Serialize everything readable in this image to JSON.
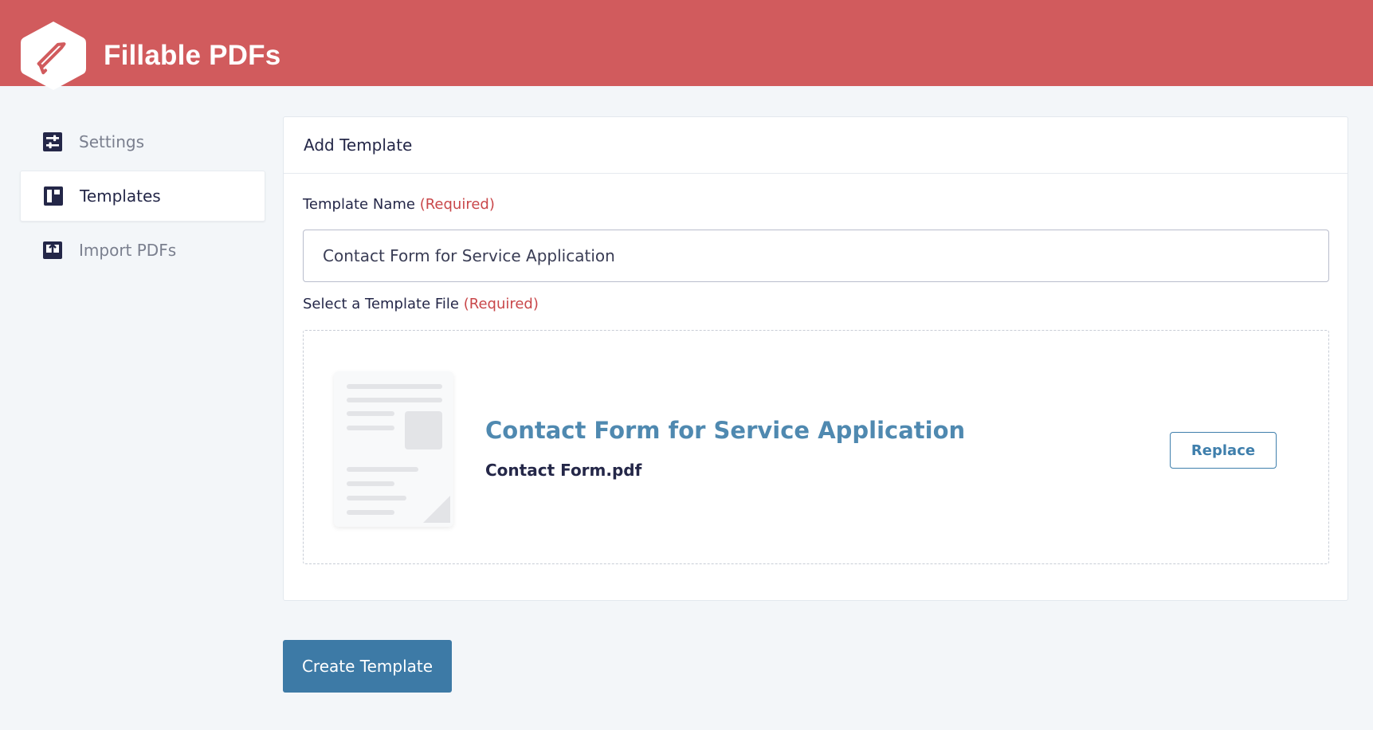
{
  "app": {
    "title": "Fillable PDFs",
    "brand_color": "#d15b5d",
    "logo_icon": "pen-icon"
  },
  "sidebar": {
    "items": [
      {
        "label": "Settings",
        "icon": "settings-sliders-icon",
        "active": false
      },
      {
        "label": "Templates",
        "icon": "templates-layout-icon",
        "active": true
      },
      {
        "label": "Import PDFs",
        "icon": "import-upload-icon",
        "active": false
      }
    ]
  },
  "card": {
    "header": "Add Template",
    "template_name_label": "Template Name",
    "required_text": "(Required)",
    "template_name_value": "Contact Form for Service Application",
    "file_label": "Select a Template File",
    "file": {
      "title": "Contact Form for Service Application",
      "filename": "Contact Form.pdf",
      "replace_label": "Replace"
    }
  },
  "actions": {
    "create_label": "Create Template",
    "create_color": "#3d7aa6"
  }
}
